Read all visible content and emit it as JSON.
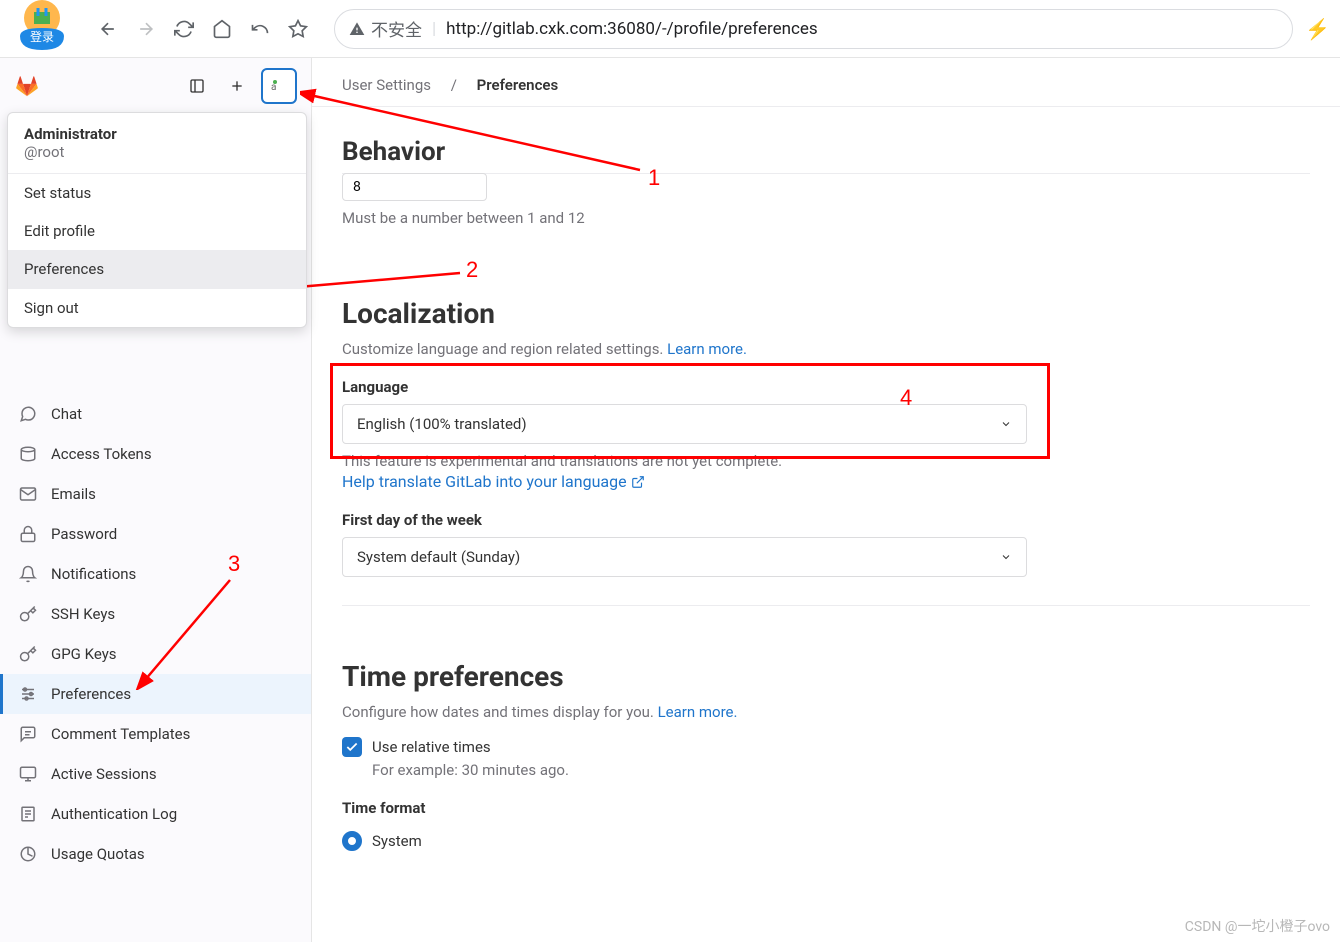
{
  "browser": {
    "login_btn": "登录",
    "security_label": "不安全",
    "url": "http://gitlab.cxk.com:36080/-/profile/preferences"
  },
  "dropdown": {
    "user_name": "Administrator",
    "user_handle": "@root",
    "items": {
      "set_status": "Set status",
      "edit_profile": "Edit profile",
      "preferences": "Preferences",
      "sign_out": "Sign out"
    }
  },
  "sidebar": {
    "items": [
      {
        "label": "Chat"
      },
      {
        "label": "Access Tokens"
      },
      {
        "label": "Emails"
      },
      {
        "label": "Password"
      },
      {
        "label": "Notifications"
      },
      {
        "label": "SSH Keys"
      },
      {
        "label": "GPG Keys"
      },
      {
        "label": "Preferences"
      },
      {
        "label": "Comment Templates"
      },
      {
        "label": "Active Sessions"
      },
      {
        "label": "Authentication Log"
      },
      {
        "label": "Usage Quotas"
      }
    ]
  },
  "breadcrumb": {
    "parent": "User Settings",
    "sep": "/",
    "current": "Preferences"
  },
  "behavior": {
    "heading": "Behavior",
    "input_value": "8",
    "help": "Must be a number between 1 and 12"
  },
  "localization": {
    "heading": "Localization",
    "desc": "Customize language and region related settings. ",
    "learn_more": "Learn more.",
    "lang_label": "Language",
    "lang_selected": "English (100% translated)",
    "lang_note": "This feature is experimental and translations are not yet complete.",
    "translate_link": "Help translate GitLab into your language",
    "dow_label": "First day of the week",
    "dow_selected": "System default (Sunday)"
  },
  "time": {
    "heading": "Time preferences",
    "desc": "Configure how dates and times display for you. ",
    "learn_more": "Learn more.",
    "cb_label": "Use relative times",
    "cb_sub": "For example: 30 minutes ago.",
    "fmt_label": "Time format",
    "fmt_system": "System"
  },
  "annotations": {
    "n1": "1",
    "n2": "2",
    "n3": "3",
    "n4": "4"
  },
  "watermark": "CSDN @一坨小橙子ovo"
}
